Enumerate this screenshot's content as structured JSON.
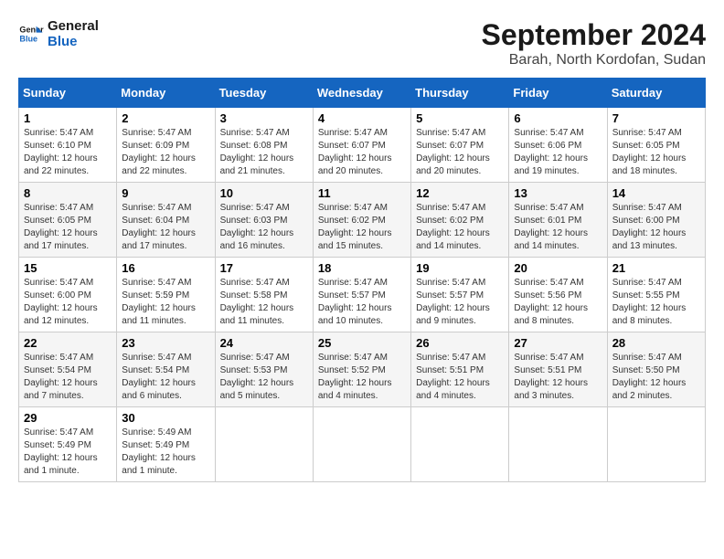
{
  "logo": {
    "line1": "General",
    "line2": "Blue"
  },
  "title": "September 2024",
  "location": "Barah, North Kordofan, Sudan",
  "days_of_week": [
    "Sunday",
    "Monday",
    "Tuesday",
    "Wednesday",
    "Thursday",
    "Friday",
    "Saturday"
  ],
  "weeks": [
    [
      {
        "day": "1",
        "sunrise": "5:47 AM",
        "sunset": "6:10 PM",
        "daylight": "12 hours and 22 minutes."
      },
      {
        "day": "2",
        "sunrise": "5:47 AM",
        "sunset": "6:09 PM",
        "daylight": "12 hours and 22 minutes."
      },
      {
        "day": "3",
        "sunrise": "5:47 AM",
        "sunset": "6:08 PM",
        "daylight": "12 hours and 21 minutes."
      },
      {
        "day": "4",
        "sunrise": "5:47 AM",
        "sunset": "6:07 PM",
        "daylight": "12 hours and 20 minutes."
      },
      {
        "day": "5",
        "sunrise": "5:47 AM",
        "sunset": "6:07 PM",
        "daylight": "12 hours and 20 minutes."
      },
      {
        "day": "6",
        "sunrise": "5:47 AM",
        "sunset": "6:06 PM",
        "daylight": "12 hours and 19 minutes."
      },
      {
        "day": "7",
        "sunrise": "5:47 AM",
        "sunset": "6:05 PM",
        "daylight": "12 hours and 18 minutes."
      }
    ],
    [
      {
        "day": "8",
        "sunrise": "5:47 AM",
        "sunset": "6:05 PM",
        "daylight": "12 hours and 17 minutes."
      },
      {
        "day": "9",
        "sunrise": "5:47 AM",
        "sunset": "6:04 PM",
        "daylight": "12 hours and 17 minutes."
      },
      {
        "day": "10",
        "sunrise": "5:47 AM",
        "sunset": "6:03 PM",
        "daylight": "12 hours and 16 minutes."
      },
      {
        "day": "11",
        "sunrise": "5:47 AM",
        "sunset": "6:02 PM",
        "daylight": "12 hours and 15 minutes."
      },
      {
        "day": "12",
        "sunrise": "5:47 AM",
        "sunset": "6:02 PM",
        "daylight": "12 hours and 14 minutes."
      },
      {
        "day": "13",
        "sunrise": "5:47 AM",
        "sunset": "6:01 PM",
        "daylight": "12 hours and 14 minutes."
      },
      {
        "day": "14",
        "sunrise": "5:47 AM",
        "sunset": "6:00 PM",
        "daylight": "12 hours and 13 minutes."
      }
    ],
    [
      {
        "day": "15",
        "sunrise": "5:47 AM",
        "sunset": "6:00 PM",
        "daylight": "12 hours and 12 minutes."
      },
      {
        "day": "16",
        "sunrise": "5:47 AM",
        "sunset": "5:59 PM",
        "daylight": "12 hours and 11 minutes."
      },
      {
        "day": "17",
        "sunrise": "5:47 AM",
        "sunset": "5:58 PM",
        "daylight": "12 hours and 11 minutes."
      },
      {
        "day": "18",
        "sunrise": "5:47 AM",
        "sunset": "5:57 PM",
        "daylight": "12 hours and 10 minutes."
      },
      {
        "day": "19",
        "sunrise": "5:47 AM",
        "sunset": "5:57 PM",
        "daylight": "12 hours and 9 minutes."
      },
      {
        "day": "20",
        "sunrise": "5:47 AM",
        "sunset": "5:56 PM",
        "daylight": "12 hours and 8 minutes."
      },
      {
        "day": "21",
        "sunrise": "5:47 AM",
        "sunset": "5:55 PM",
        "daylight": "12 hours and 8 minutes."
      }
    ],
    [
      {
        "day": "22",
        "sunrise": "5:47 AM",
        "sunset": "5:54 PM",
        "daylight": "12 hours and 7 minutes."
      },
      {
        "day": "23",
        "sunrise": "5:47 AM",
        "sunset": "5:54 PM",
        "daylight": "12 hours and 6 minutes."
      },
      {
        "day": "24",
        "sunrise": "5:47 AM",
        "sunset": "5:53 PM",
        "daylight": "12 hours and 5 minutes."
      },
      {
        "day": "25",
        "sunrise": "5:47 AM",
        "sunset": "5:52 PM",
        "daylight": "12 hours and 4 minutes."
      },
      {
        "day": "26",
        "sunrise": "5:47 AM",
        "sunset": "5:51 PM",
        "daylight": "12 hours and 4 minutes."
      },
      {
        "day": "27",
        "sunrise": "5:47 AM",
        "sunset": "5:51 PM",
        "daylight": "12 hours and 3 minutes."
      },
      {
        "day": "28",
        "sunrise": "5:47 AM",
        "sunset": "5:50 PM",
        "daylight": "12 hours and 2 minutes."
      }
    ],
    [
      {
        "day": "29",
        "sunrise": "5:47 AM",
        "sunset": "5:49 PM",
        "daylight": "12 hours and 1 minute."
      },
      {
        "day": "30",
        "sunrise": "5:49 AM",
        "sunset": "5:49 PM",
        "daylight": "12 hours and 1 minute."
      },
      null,
      null,
      null,
      null,
      null
    ]
  ]
}
